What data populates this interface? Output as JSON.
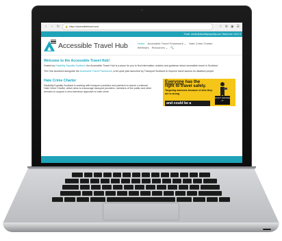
{
  "browser": {
    "url": "https://accessibletravel.scot",
    "nav_back": "‹",
    "nav_forward": "›",
    "nav_reload": "↻",
    "icons": [
      "star-icon",
      "extensions-icon",
      "account-icon",
      "menu-icon"
    ]
  },
  "contact_strip": "Email: admin@disabilityequality.scot  Telephone: 0141 5",
  "header": {
    "site_title": "Accessible Travel Hub",
    "nav_row1": [
      "Home",
      "Accessible Travel Framework ⌄",
      "Hate Crime Charter"
    ],
    "nav_row2": [
      "Webinars",
      "Resources ⌄",
      "🔍"
    ]
  },
  "welcome": {
    "title": "Welcome to the Accessible Travel Hub!",
    "p1_prefix": "Hosted by ",
    "p1_link": "Disability Equality Scotland",
    "p1_suffix": ", the Accessible Travel Hub is a place for you to find information, articles and guidance about accessible travel in Scotland.",
    "p2_prefix": "The Hub launched alongside the ",
    "p2_link": "Accessible Travel Framework",
    "p2_suffix": ", a ten-year plan launched by Transport Scotland to improve travel access for disabled people."
  },
  "charter": {
    "title": "Hate Crime Charter",
    "body": "Disability Equality Scotland is working with transport providers and partners to launch a national Hate Crime Charter, which aims to encourage transport providers, members of the public and other services to support a zero-tolerance approach to hate crime."
  },
  "poster": {
    "line1_u": "Everyone",
    "line1_rest": " has the",
    "line2": "right to travel safely.",
    "sub": "Targeting someone because of who they are is wrong",
    "dark": "and could be a",
    "badge": "DON'T IGNORE IT",
    "accent": "#f5c518"
  },
  "colors": {
    "brand": "#17a8c0",
    "strip": "#1ea3b8"
  }
}
